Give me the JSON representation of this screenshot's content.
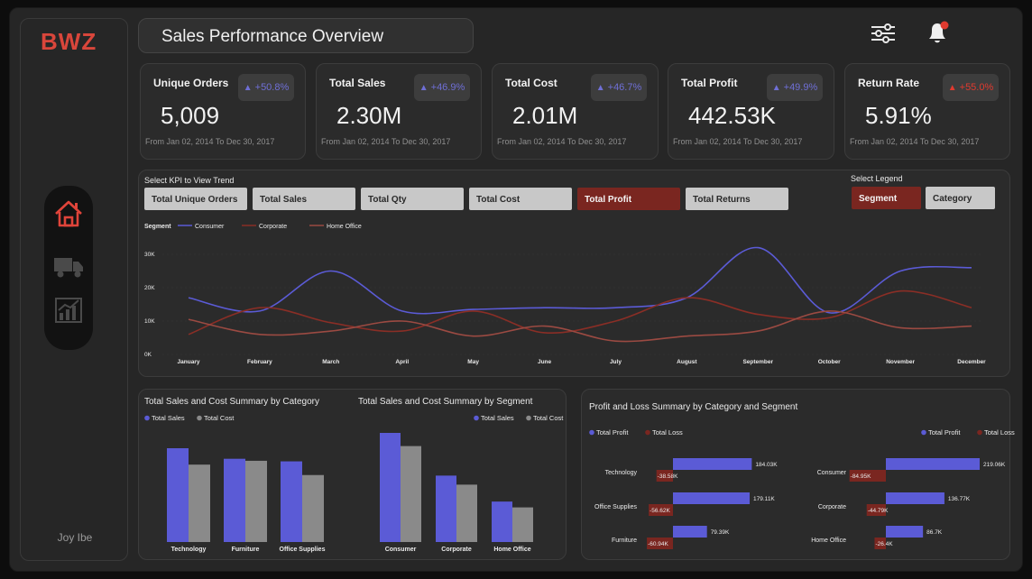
{
  "brand": {
    "logo": "BWZ",
    "author": "Joy Ibe"
  },
  "header": {
    "title": "Sales Performance Overview"
  },
  "icons": {
    "filter": "sliders-icon",
    "bell": "bell-icon",
    "home": "home-icon",
    "truck": "truck-icon",
    "chart": "chart-icon"
  },
  "colors": {
    "accent": "#5b5bd6",
    "red": "#7a2620",
    "brand": "#d9463b",
    "gray": "#8a8a8a"
  },
  "kpis": [
    {
      "label": "Unique Orders",
      "value": "5,009",
      "change": "+50.8%",
      "period": "From Jan 02, 2014 To Dec 30, 2017",
      "dir": "up"
    },
    {
      "label": "Total Sales",
      "value": "2.30M",
      "change": "+46.9%",
      "period": "From Jan 02, 2014 To Dec 30, 2017",
      "dir": "up"
    },
    {
      "label": "Total Cost",
      "value": "2.01M",
      "change": "+46.7%",
      "period": "From Jan 02, 2014 To Dec 30, 2017",
      "dir": "up"
    },
    {
      "label": "Total Profit",
      "value": "442.53K",
      "change": "+49.9%",
      "period": "From Jan 02, 2014 To Dec 30, 2017",
      "dir": "up"
    },
    {
      "label": "Return Rate",
      "value": "5.91%",
      "change": "+55.0%",
      "period": "From Jan 02, 2014 To Dec 30, 2017",
      "dir": "up-bad"
    }
  ],
  "trend": {
    "select_label": "Select KPI to View Trend",
    "kpi_buttons": [
      "Total Unique Orders",
      "Total Sales",
      "Total Qty",
      "Total Cost",
      "Total Profit",
      "Total Returns"
    ],
    "active_kpi": "Total Profit",
    "legend_select_label": "Select Legend",
    "legend_buttons": [
      "Segment",
      "Category"
    ],
    "active_legend": "Segment"
  },
  "chart_data": [
    {
      "type": "line",
      "legend_title": "Segment",
      "x": [
        "January",
        "February",
        "March",
        "April",
        "May",
        "June",
        "July",
        "August",
        "September",
        "October",
        "November",
        "December"
      ],
      "y_ticks": [
        "0K",
        "10K",
        "20K",
        "30K"
      ],
      "ylim": [
        0,
        30000
      ],
      "series": [
        {
          "name": "Consumer",
          "color": "#5b5bd6",
          "values": [
            17000,
            13000,
            25000,
            13000,
            13500,
            14000,
            14000,
            17000,
            32000,
            12500,
            25000,
            26000
          ]
        },
        {
          "name": "Corporate",
          "color": "#8a2e26",
          "values": [
            6000,
            14000,
            9500,
            7000,
            13000,
            6500,
            10000,
            17000,
            12000,
            11000,
            19000,
            14000
          ]
        },
        {
          "name": "Home Office",
          "color": "#9b4a42",
          "values": [
            10500,
            6000,
            7000,
            10000,
            5500,
            8500,
            4000,
            5500,
            7000,
            13000,
            8000,
            8500
          ]
        }
      ]
    },
    {
      "type": "bar",
      "title": "Total Sales and Cost Summary by Category",
      "categories": [
        "Technology",
        "Furniture",
        "Office Supplies"
      ],
      "series": [
        {
          "name": "Total Sales",
          "color": "#5b5bd6",
          "values": [
            836000,
            742000,
            719000
          ]
        },
        {
          "name": "Total Cost",
          "color": "#8a8a8a",
          "values": [
            690000,
            724000,
            597000
          ]
        }
      ]
    },
    {
      "type": "bar",
      "title": "Total Sales and Cost Summary by Segment",
      "categories": [
        "Consumer",
        "Corporate",
        "Home Office"
      ],
      "series": [
        {
          "name": "Total Sales",
          "color": "#5b5bd6",
          "values": [
            1160000,
            706000,
            430000
          ]
        },
        {
          "name": "Total Cost",
          "color": "#8a8a8a",
          "values": [
            1020000,
            610000,
            368000
          ]
        }
      ]
    },
    {
      "type": "bar",
      "title": "Profit and Loss Summary by Category and Segment",
      "series_names": [
        "Total Profit",
        "Total Loss"
      ],
      "groups": [
        {
          "name": "Category",
          "categories": [
            "Technology",
            "Office Supplies",
            "Furniture"
          ],
          "profit": [
            184030,
            179110,
            79390
          ],
          "loss": [
            -38580,
            -56620,
            -60940
          ],
          "profit_labels": [
            "184.03K",
            "179.11K",
            "79.39K"
          ],
          "loss_labels": [
            "-38.58K",
            "-56.62K",
            "-60.94K"
          ]
        },
        {
          "name": "Segment",
          "categories": [
            "Consumer",
            "Corporate",
            "Home Office"
          ],
          "profit": [
            219060,
            136770,
            86700
          ],
          "loss": [
            -84950,
            -44790,
            -26400
          ],
          "profit_labels": [
            "219.06K",
            "136.77K",
            "86.7K"
          ],
          "loss_labels": [
            "-84.95K",
            "-44.79K",
            "-26.4K"
          ]
        }
      ]
    }
  ]
}
